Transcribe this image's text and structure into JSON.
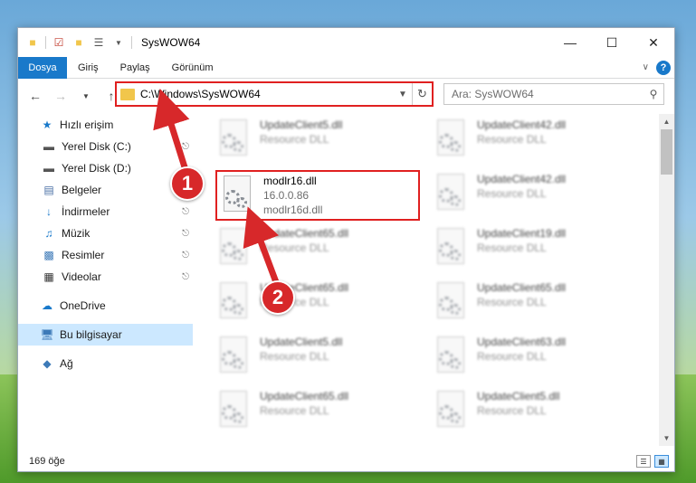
{
  "window": {
    "title": "SysWOW64"
  },
  "ribbon": {
    "tabs": [
      "Dosya",
      "Giriş",
      "Paylaş",
      "Görünüm"
    ]
  },
  "address": {
    "path": "C:\\Windows\\SysWOW64"
  },
  "search": {
    "placeholder": "Ara: SysWOW64"
  },
  "sidebar": {
    "quick_access": "Hızlı erişim",
    "items": [
      {
        "label": "Yerel Disk (C:)",
        "icon": "drive-icon",
        "pinned": true
      },
      {
        "label": "Yerel Disk (D:)",
        "icon": "drive-icon",
        "pinned": false
      },
      {
        "label": "Belgeler",
        "icon": "documents-icon",
        "pinned": true
      },
      {
        "label": "İndirmeler",
        "icon": "downloads-icon",
        "pinned": true
      },
      {
        "label": "Müzik",
        "icon": "music-icon",
        "pinned": true
      },
      {
        "label": "Resimler",
        "icon": "pictures-icon",
        "pinned": true
      },
      {
        "label": "Videolar",
        "icon": "videos-icon",
        "pinned": true
      }
    ],
    "onedrive": "OneDrive",
    "this_pc": "Bu bilgisayar",
    "network": "Ağ"
  },
  "files": {
    "left": [
      {
        "name": "UpdateClient5.dll",
        "desc": "Resource DLL"
      },
      {
        "name": "modlr16.dll",
        "desc": "16.0.0.86",
        "desc2": "modlr16d.dll"
      },
      {
        "name": "UpdateClient65.dll",
        "desc": "Resource DLL"
      },
      {
        "name": "UpdateClient65.dll",
        "desc": "Resource DLL"
      },
      {
        "name": "UpdateClient5.dll",
        "desc": "Resource DLL"
      },
      {
        "name": "UpdateClient65.dll",
        "desc": "Resource DLL"
      }
    ],
    "right": [
      {
        "name": "UpdateClient42.dll",
        "desc": "Resource DLL"
      },
      {
        "name": "UpdateClient42.dll",
        "desc": "Resource DLL"
      },
      {
        "name": "UpdateClient19.dll",
        "desc": "Resource DLL"
      },
      {
        "name": "UpdateClient65.dll",
        "desc": "Resource DLL"
      },
      {
        "name": "UpdateClient63.dll",
        "desc": "Resource DLL"
      },
      {
        "name": "UpdateClient5.dll",
        "desc": "Resource DLL"
      }
    ]
  },
  "status": {
    "count": "169 öğe"
  },
  "annotations": {
    "step1": "1",
    "step2": "2"
  },
  "colors": {
    "accent": "#1979ca",
    "highlight": "#e02020",
    "badge": "#d7282a"
  }
}
